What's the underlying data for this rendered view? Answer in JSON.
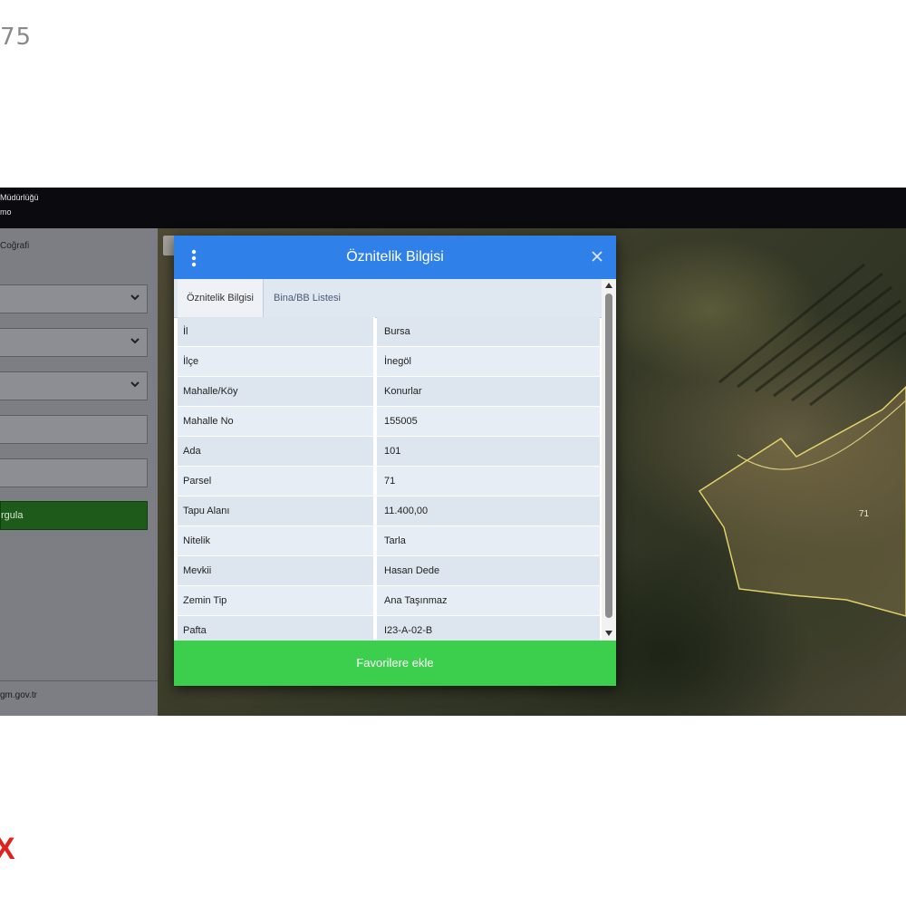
{
  "watermark": {
    "number": "75",
    "mark": "X"
  },
  "topbar": {
    "line1": "Müdürlüğü",
    "line2": "mo"
  },
  "sidebar": {
    "label": "Coğrafi",
    "button_label": "rgula",
    "footer": "gm.gov.tr"
  },
  "map": {
    "parcel_label": "71"
  },
  "modal": {
    "title": "Öznitelik Bilgisi",
    "tabs": [
      {
        "label": "Öznitelik Bilgisi"
      },
      {
        "label": "Bina/BB Listesi"
      }
    ],
    "rows": [
      {
        "key": "İl",
        "value": "Bursa"
      },
      {
        "key": "İlçe",
        "value": "İnegöl"
      },
      {
        "key": "Mahalle/Köy",
        "value": "Konurlar"
      },
      {
        "key": "Mahalle No",
        "value": "155005"
      },
      {
        "key": "Ada",
        "value": "101"
      },
      {
        "key": "Parsel",
        "value": "71"
      },
      {
        "key": "Tapu Alanı",
        "value": "11.400,00"
      },
      {
        "key": "Nitelik",
        "value": "Tarla"
      },
      {
        "key": "Mevkii",
        "value": "Hasan Dede"
      },
      {
        "key": "Zemin Tip",
        "value": "Ana Taşınmaz"
      },
      {
        "key": "Pafta",
        "value": "I23-A-02-B"
      }
    ],
    "favorite_button": "Favorilere ekle"
  }
}
